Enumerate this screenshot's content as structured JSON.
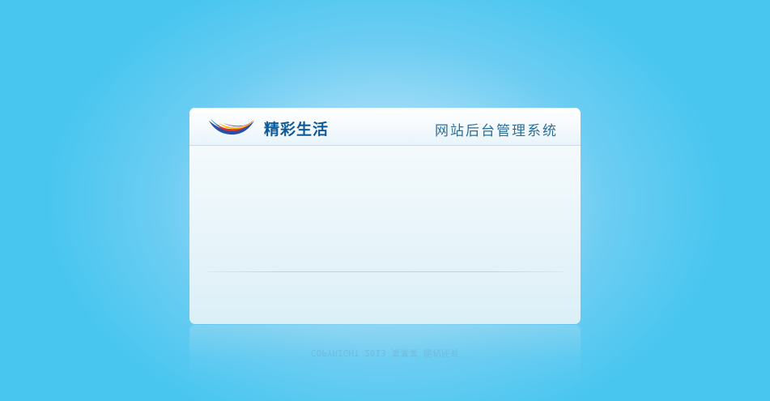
{
  "header": {
    "brand_name": "精彩生活",
    "system_title": "网站后台管理系统"
  },
  "footer": {
    "reflection_text": "COPYRIGHT 2013 某某某 版权所有"
  },
  "colors": {
    "background": "#48c6f0",
    "brand_text": "#0d5a9a",
    "title_text": "#2a6f9c",
    "divider": "#b7d6e4"
  },
  "icons": {
    "logo": "brand-logo-icon"
  }
}
